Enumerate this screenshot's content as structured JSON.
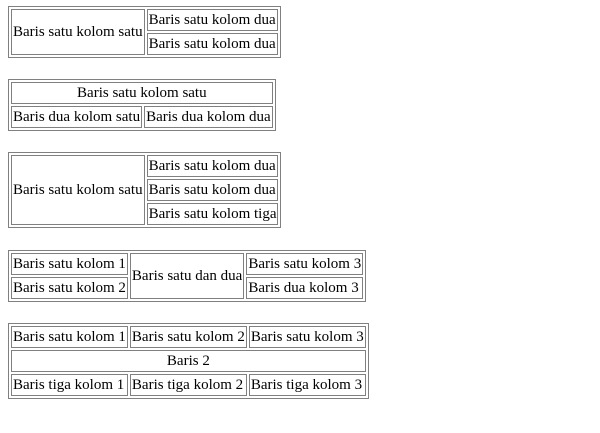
{
  "table1": {
    "r1c1": "Baris satu kolom satu",
    "r1c2": "Baris satu kolom dua",
    "r2c2": "Baris satu kolom dua"
  },
  "table2": {
    "header": "Baris satu kolom satu",
    "r2c1": "Baris dua kolom satu",
    "r2c2": "Baris dua kolom dua"
  },
  "table3": {
    "r1c1": "Baris satu kolom satu",
    "r1c2": "Baris satu kolom dua",
    "r2c2": "Baris satu kolom dua",
    "r3c2": "Baris satu kolom tiga"
  },
  "table4": {
    "r1c1": "Baris satu kolom 1",
    "r1c2": "Baris satu dan dua",
    "r1c3": "Baris satu kolom 3",
    "r2c1": "Baris satu kolom 2",
    "r2c3": "Baris dua kolom 3"
  },
  "table5": {
    "r1c1": "Baris satu kolom 1",
    "r1c2": "Baris satu kolom 2",
    "r1c3": "Baris satu kolom 3",
    "r2": "Baris 2",
    "r3c1": "Baris tiga kolom 1",
    "r3c2": "Baris tiga kolom 2",
    "r3c3": "Baris tiga kolom 3"
  }
}
